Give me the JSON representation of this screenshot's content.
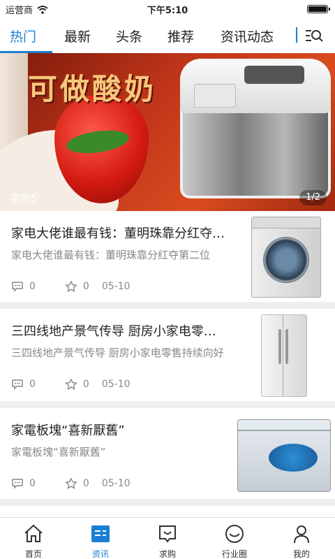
{
  "status_bar": {
    "carrier": "运营商",
    "time": "下午5:10"
  },
  "tabs": [
    {
      "label": "热门",
      "active": true
    },
    {
      "label": "最新",
      "active": false
    },
    {
      "label": "头条",
      "active": false
    },
    {
      "label": "推荐",
      "active": false
    },
    {
      "label": "资讯动态",
      "active": false
    }
  ],
  "tab_menu_icon": "list-search-icon",
  "banner": {
    "image_text": "可做酸奶",
    "caption": "家电5",
    "counter": "1/2"
  },
  "news": [
    {
      "headline": "家电大佬谁最有钱：董明珠靠分红夺第二位",
      "summary": "家电大佬谁最有钱：董明珠靠分红夺第二位",
      "comments": "0",
      "stars": "0",
      "date": "05-10",
      "thumb": "washing-machine-image"
    },
    {
      "headline": "三四线地产景气传导 厨房小家电零售持续向好",
      "summary": "三四线地产景气传导 厨房小家电零售持续向好",
      "comments": "0",
      "stars": "0",
      "date": "05-10",
      "thumb": "refrigerator-image"
    },
    {
      "headline": "家電板塊“喜新厭舊”",
      "summary": "家電板塊“喜新厭舊”",
      "comments": "0",
      "stars": "0",
      "date": "05-10",
      "thumb": "freezer-image"
    }
  ],
  "bottom_nav": [
    {
      "label": "首页",
      "icon": "home-icon",
      "active": false
    },
    {
      "label": "资讯",
      "icon": "news-icon",
      "active": true
    },
    {
      "label": "求购",
      "icon": "purchase-icon",
      "active": false
    },
    {
      "label": "行业圈",
      "icon": "circle-icon",
      "active": false
    },
    {
      "label": "我的",
      "icon": "user-icon",
      "active": false
    }
  ],
  "colors": {
    "accent": "#1a7fd4",
    "text": "#222222",
    "muted": "#888888",
    "separator": "#efefef"
  }
}
